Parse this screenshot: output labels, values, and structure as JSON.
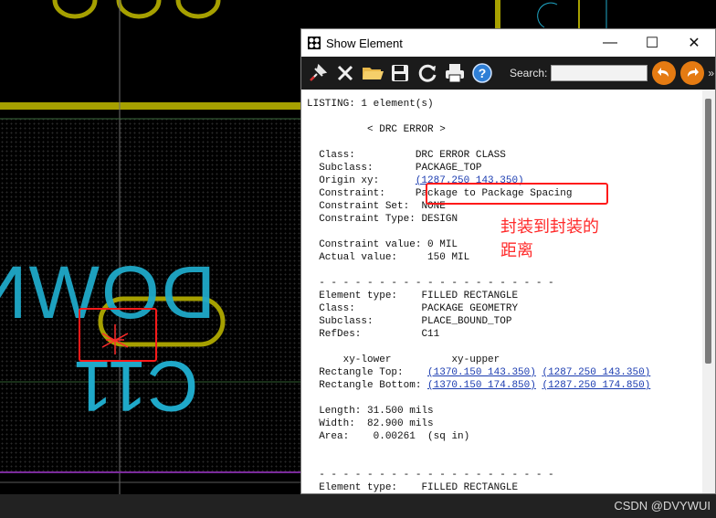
{
  "window": {
    "title": "Show Element",
    "minimize_glyph": "—",
    "maximize_glyph": "☐",
    "close_glyph": "✕"
  },
  "toolbar": {
    "icons": [
      "pin-icon",
      "close-x-icon",
      "open-folder-icon",
      "save-icon",
      "refresh-icon",
      "print-icon",
      "help-icon"
    ],
    "search_label": "Search:",
    "search_value": "",
    "back_icon": "back-arrow-icon",
    "forward_icon": "forward-arrow-icon",
    "more_label": "»"
  },
  "listing": {
    "header": "LISTING: 1 element(s)",
    "section_title": "< DRC ERROR >",
    "class_label": "Class:",
    "class_value": "DRC ERROR CLASS",
    "subclass_label": "Subclass:",
    "subclass_value": "PACKAGE_TOP",
    "origin_label": "Origin xy:",
    "origin_value": "(1287.250 143.350)",
    "constraint_label": "Constraint:",
    "constraint_value": "Package to Package Spacing",
    "constraint_set_label": "Constraint Set:",
    "constraint_set_value": "NONE",
    "constraint_type_label": "Constraint Type:",
    "constraint_type_value": "DESIGN",
    "constraint_value_label": "Constraint value:",
    "constraint_value_value": "0 MIL",
    "actual_label": "Actual value:",
    "actual_value": "150 MIL",
    "divider": "- - - - - - - - - - - - - - - - - - - -",
    "el1_type_label": "Element type:",
    "el1_type_value": "FILLED RECTANGLE",
    "el1_class_label": "Class:",
    "el1_class_value": "PACKAGE GEOMETRY",
    "el1_subclass_label": "Subclass:",
    "el1_subclass_value": "PLACE_BOUND_TOP",
    "el1_refdes_label": "RefDes:",
    "el1_refdes_value": "C11",
    "xy_lower_header": "xy-lower",
    "xy_upper_header": "xy-upper",
    "rect_top_label": "Rectangle Top:",
    "rect_top_lower": "(1370.150 143.350)",
    "rect_top_upper": "(1287.250 143.350)",
    "rect_bottom_label": "Rectangle Bottom:",
    "rect_bottom_lower": "(1370.150 174.850)",
    "rect_bottom_upper": "(1287.250 174.850)",
    "length_label": "Length:",
    "length_value": "31.500 mils",
    "width_label": "Width:",
    "width_value": "82.900 mils",
    "area_label": "Area:",
    "area_value": "0.00261  (sq in)",
    "el2_type_label": "Element type:",
    "el2_type_value": "FILLED RECTANGLE"
  },
  "annotation": {
    "line1": "封装到封装的",
    "line2": "距离"
  },
  "pcb": {
    "silk_text_1": "DOWN",
    "silk_text_2": "C11"
  },
  "watermark": "CSDN @DVYWUI",
  "colors": {
    "highlight": "#ff1a1a",
    "silkscreen": "#1fa9c9",
    "outline": "#a6a000",
    "drc_marker": "#ff2a2a",
    "toolbar_bg": "#1b1b1b",
    "nav_button": "#e57b12"
  }
}
